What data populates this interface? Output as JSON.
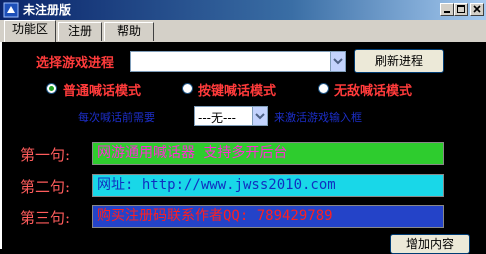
{
  "window": {
    "title": "未注册版"
  },
  "tabs": [
    {
      "label": "功能区"
    },
    {
      "label": "注册"
    },
    {
      "label": "帮助"
    }
  ],
  "game_select": {
    "label": "选择游戏进程",
    "value": "",
    "refresh_label": "刷新进程"
  },
  "modes": [
    {
      "label": "普通喊话模式",
      "checked": true
    },
    {
      "label": "按键喊话模式",
      "checked": false
    },
    {
      "label": "无敌喊话模式",
      "checked": false
    }
  ],
  "pre_send": {
    "label": "每次喊话前需要",
    "value": "---无---",
    "suffix": "来激活游戏输入框"
  },
  "messages": [
    {
      "prefix": "第一句:",
      "text": "网游通用喊话器 支持多开后台",
      "bg": "#2ecc2e",
      "color": "#ff2bd6"
    },
    {
      "prefix": "第二句:",
      "text": "网址: http://www.jwss2010.com",
      "bg": "#19d7e8",
      "color": "#1030c0"
    },
    {
      "prefix": "第三句:",
      "text": "购买注册码联系作者QQ: 789429789",
      "bg": "#2443c8",
      "color": "#ff1f1f"
    }
  ],
  "add_button_label": "增加内容",
  "colors": {
    "label_red": "#ff3b3b",
    "hint_blue": "#1c2ec8",
    "prefix_red": "#ff5c5c"
  }
}
